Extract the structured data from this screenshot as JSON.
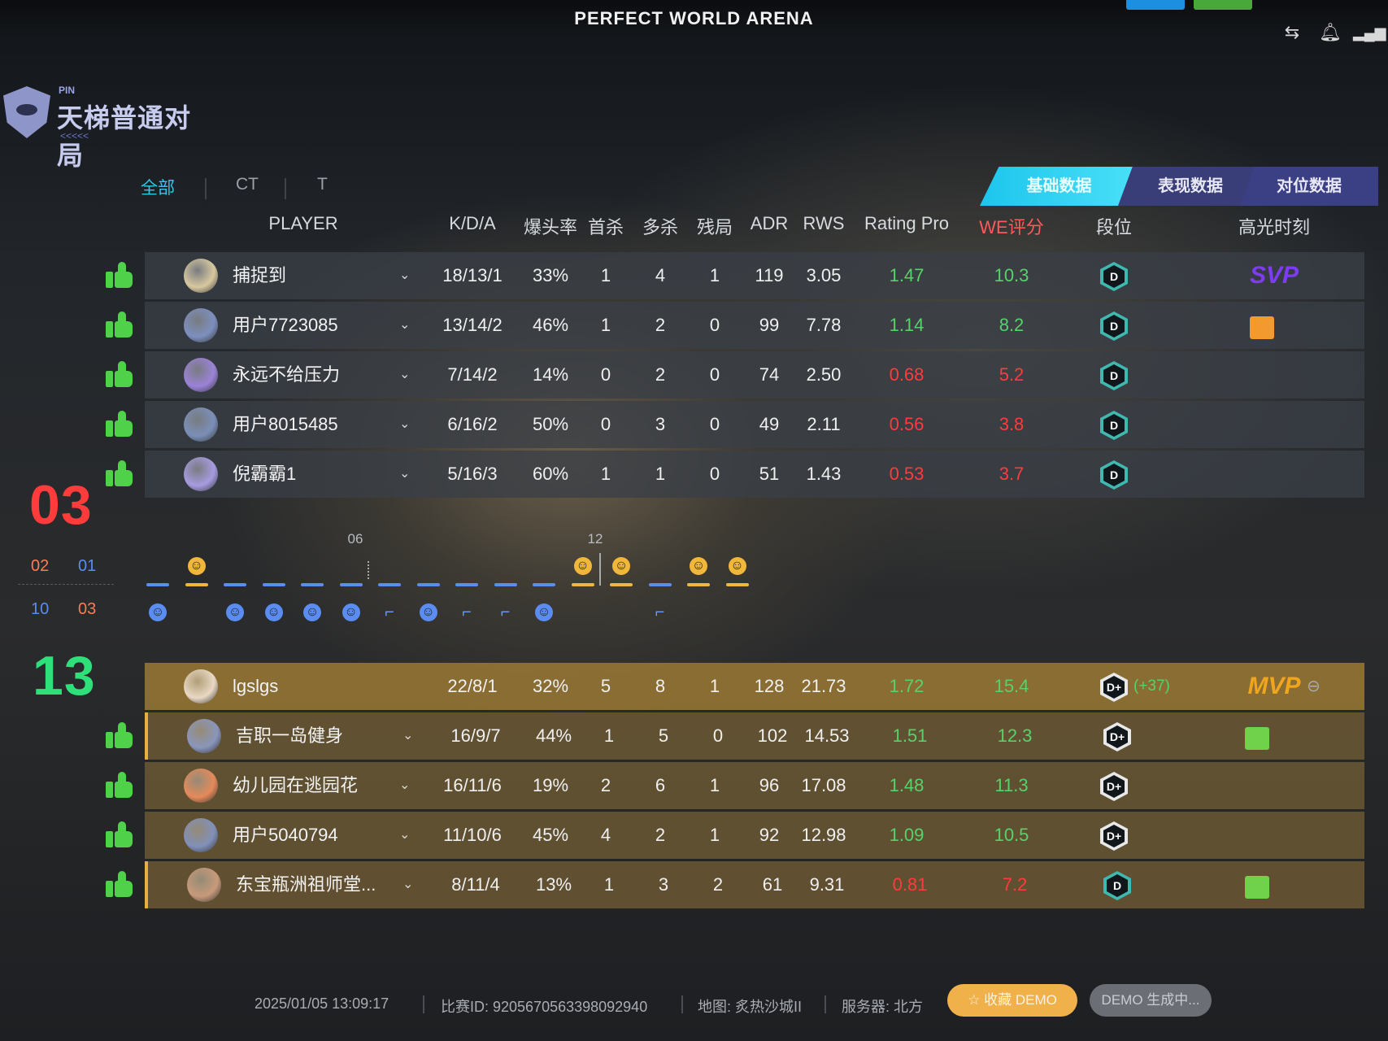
{
  "app": {
    "title": "PERFECT WORLD ARENA"
  },
  "logo": {
    "small": "PIN",
    "name": "天梯普通对局",
    "arrows": "<<<<<"
  },
  "filter_tabs": [
    {
      "label": "全部",
      "active": true
    },
    {
      "label": "CT",
      "active": false
    },
    {
      "label": "T",
      "active": false
    }
  ],
  "data_tabs": [
    {
      "label": "基础数据",
      "active": true
    },
    {
      "label": "表现数据",
      "active": false
    },
    {
      "label": "对位数据",
      "active": false
    }
  ],
  "columns": {
    "player": "PLAYER",
    "kda": "K/D/A",
    "hs": "爆头率",
    "first_kill": "首杀",
    "multi_kill": "多杀",
    "clutch": "残局",
    "adr": "ADR",
    "rws": "RWS",
    "rating": "Rating Pro",
    "we": "WE评分",
    "rank": "段位",
    "highlight": "高光时刻"
  },
  "team1": {
    "score": "03",
    "half_scores": [
      "02",
      "01"
    ],
    "color": "#ff3b3b",
    "players": [
      {
        "name": "捕捉到",
        "kda": "18/13/1",
        "hs": "33%",
        "first_kill": "1",
        "multi_kill": "4",
        "clutch": "1",
        "adr": "119",
        "rws": "3.05",
        "rating": "1.47",
        "rating_status": "good",
        "we": "10.3",
        "we_status": "good",
        "rank": "D",
        "highlight": "SVP"
      },
      {
        "name": "用户7723085",
        "kda": "13/14/2",
        "hs": "46%",
        "first_kill": "1",
        "multi_kill": "2",
        "clutch": "0",
        "adr": "99",
        "rws": "7.78",
        "rating": "1.14",
        "rating_status": "good",
        "we": "8.2",
        "we_status": "good",
        "rank": "D",
        "highlight": "badge-orange"
      },
      {
        "name": "永远不给压力",
        "kda": "7/14/2",
        "hs": "14%",
        "first_kill": "0",
        "multi_kill": "2",
        "clutch": "0",
        "adr": "74",
        "rws": "2.50",
        "rating": "0.68",
        "rating_status": "bad",
        "we": "5.2",
        "we_status": "bad",
        "rank": "D",
        "highlight": ""
      },
      {
        "name": "用户8015485",
        "kda": "6/16/2",
        "hs": "50%",
        "first_kill": "0",
        "multi_kill": "3",
        "clutch": "0",
        "adr": "49",
        "rws": "2.11",
        "rating": "0.56",
        "rating_status": "bad",
        "we": "3.8",
        "we_status": "bad",
        "rank": "D",
        "highlight": ""
      },
      {
        "name": "倪霸霸1",
        "kda": "5/16/3",
        "hs": "60%",
        "first_kill": "1",
        "multi_kill": "1",
        "clutch": "0",
        "adr": "51",
        "rws": "1.43",
        "rating": "0.53",
        "rating_status": "bad",
        "we": "3.7",
        "we_status": "bad",
        "rank": "D",
        "highlight": ""
      }
    ]
  },
  "team2": {
    "score": "13",
    "half_scores": [
      "10",
      "03"
    ],
    "color": "#2ee07a",
    "players": [
      {
        "name": "lgslgs",
        "kda": "22/8/1",
        "hs": "32%",
        "first_kill": "5",
        "multi_kill": "8",
        "clutch": "1",
        "adr": "128",
        "rws": "21.73",
        "rating": "1.72",
        "rating_status": "good",
        "we": "15.4",
        "we_status": "good",
        "rank": "D+",
        "rank_change": "(+37)",
        "highlight": "MVP"
      },
      {
        "name": "吉职一岛健身",
        "kda": "16/9/7",
        "hs": "44%",
        "first_kill": "1",
        "multi_kill": "5",
        "clutch": "0",
        "adr": "102",
        "rws": "14.53",
        "rating": "1.51",
        "rating_status": "good",
        "we": "12.3",
        "we_status": "good",
        "rank": "D+",
        "highlight": "badge-green"
      },
      {
        "name": "幼儿园在逃园花",
        "kda": "16/11/6",
        "hs": "19%",
        "first_kill": "2",
        "multi_kill": "6",
        "clutch": "1",
        "adr": "96",
        "rws": "17.08",
        "rating": "1.48",
        "rating_status": "good",
        "we": "11.3",
        "we_status": "good",
        "rank": "D+",
        "highlight": ""
      },
      {
        "name": "用户5040794",
        "kda": "11/10/6",
        "hs": "45%",
        "first_kill": "4",
        "multi_kill": "2",
        "clutch": "1",
        "adr": "92",
        "rws": "12.98",
        "rating": "1.09",
        "rating_status": "good",
        "we": "10.5",
        "we_status": "good",
        "rank": "D+",
        "highlight": ""
      },
      {
        "name": "东宝瓶洲祖师堂...",
        "kda": "8/11/4",
        "hs": "13%",
        "first_kill": "1",
        "multi_kill": "3",
        "clutch": "2",
        "adr": "61",
        "rws": "9.31",
        "rating": "0.81",
        "rating_status": "bad",
        "we": "7.2",
        "we_status": "bad",
        "rank": "D",
        "highlight": "badge-green"
      }
    ]
  },
  "timeline": {
    "round_markers": [
      "06",
      "12"
    ],
    "rounds": [
      {
        "winner": "team2",
        "icon": "blue-face"
      },
      {
        "winner": "team1",
        "icon": "yellow-face"
      },
      {
        "winner": "team2",
        "icon": "blue-face"
      },
      {
        "winner": "team2",
        "icon": "blue-face"
      },
      {
        "winner": "team2",
        "icon": "blue-face"
      },
      {
        "winner": "team2",
        "icon": "blue-face"
      },
      {
        "winner": "team2",
        "icon": "defuse"
      },
      {
        "winner": "team2",
        "icon": "blue-face"
      },
      {
        "winner": "team2",
        "icon": "defuse"
      },
      {
        "winner": "team2",
        "icon": "defuse"
      },
      {
        "winner": "team2",
        "icon": "blue-face"
      },
      {
        "winner": "team1",
        "icon": "yellow-face"
      },
      {
        "winner": "team1",
        "icon": "yellow-face"
      },
      {
        "winner": "team2",
        "icon": "defuse"
      },
      {
        "winner": "team1",
        "icon": "yellow-face"
      },
      {
        "winner": "team1",
        "icon": "yellow-face"
      }
    ]
  },
  "footer": {
    "datetime": "2025/01/05 13:09:17",
    "match_id": "比赛ID: 9205670563398092940",
    "map": "地图: 炙热沙城II",
    "server": "服务器: 北方",
    "save_demo": "收藏 DEMO",
    "demo_status": "DEMO 生成中..."
  },
  "colors": {
    "accent": "#31d3f2",
    "good": "#57d26b",
    "bad": "#ff3b3b",
    "mvp": "#f0a51e",
    "svp": "#7c3cf5",
    "ct_blue": "#5b8cf2",
    "t_yellow": "#f0b73a"
  }
}
